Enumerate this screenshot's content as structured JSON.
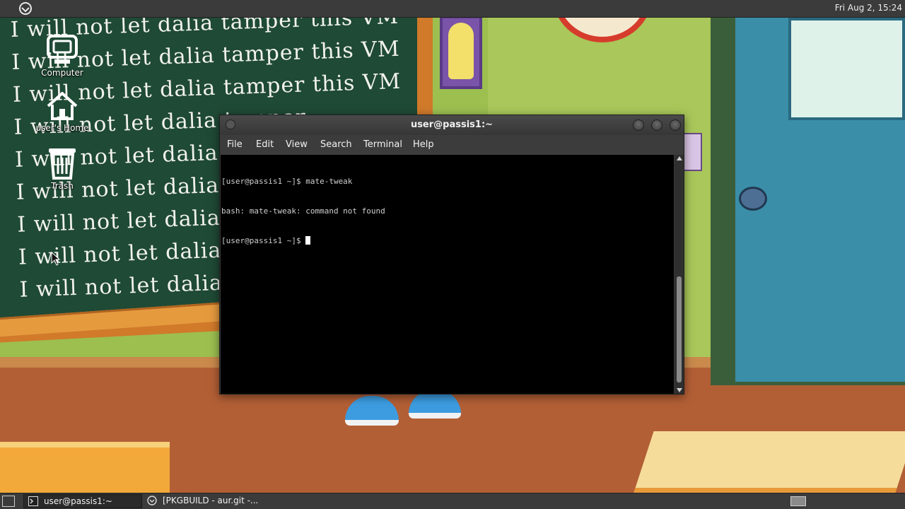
{
  "top_panel": {
    "clock": "Fri Aug  2, 15:24"
  },
  "desktop_icons": [
    {
      "label": "Computer",
      "icon": "computer-icon"
    },
    {
      "label": "user's Home",
      "icon": "home-icon"
    },
    {
      "label": "Trash",
      "icon": "trash-icon"
    }
  ],
  "wallpaper": {
    "chalk_lines": [
      "I  will not  let  dalia tamper this VM",
      "I  will not  let  dalia tamper this VM",
      "I  will not  let  dalia tamper this VM",
      "I  will not  let  dalia tamper",
      "I  will not  let  dalia tamper",
      "I  will not  let  dalia tamper",
      "I  will not  let  dalia tamper",
      "I  will not  let  dalia tamper",
      "I  will not  let  dalia tamper"
    ]
  },
  "terminal": {
    "title": "user@passis1:~",
    "menu": [
      "File",
      "Edit",
      "View",
      "Search",
      "Terminal",
      "Help"
    ],
    "lines": [
      "[user@passis1 ~]$ mate-tweak",
      "bash: mate-tweak: command not found"
    ],
    "prompt": "[user@passis1 ~]$ "
  },
  "taskbar": {
    "tasks": [
      {
        "label": "user@passis1:~",
        "active": true,
        "icon": "terminal-icon"
      },
      {
        "label": "[PKGBUILD - aur.git -...",
        "active": false,
        "icon": "app-icon"
      }
    ]
  }
}
